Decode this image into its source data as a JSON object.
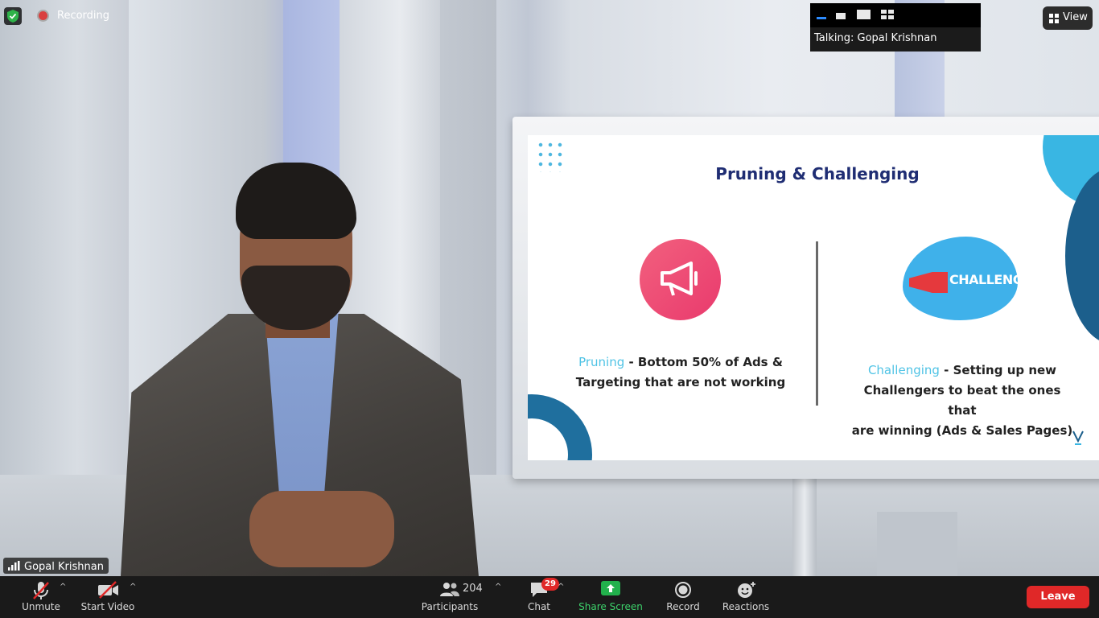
{
  "topbar": {
    "recording_label": "Recording",
    "talking_label": "Talking: Gopal Krishnan",
    "view_label": "View"
  },
  "video": {
    "participant_name": "Gopal Krishnan"
  },
  "slide": {
    "title": "Pruning & Challenging",
    "left_highlight": "Pruning",
    "left_line1": " - Bottom 50% of Ads &",
    "left_line2": "Targeting that are not working",
    "right_highlight": "Challenging",
    "right_line1": " - Setting up new",
    "right_line2": "Challengers to beat the ones that",
    "right_line3": "are winning (Ads & Sales Pages)",
    "challenge_graphic_text": "CHALLENGE"
  },
  "toolbar": {
    "unmute_label": "Unmute",
    "start_video_label": "Start Video",
    "participants_label": "Participants",
    "participants_count": "204",
    "chat_label": "Chat",
    "chat_badge": "29",
    "share_screen_label": "Share Screen",
    "record_label": "Record",
    "reactions_label": "Reactions",
    "leave_label": "Leave"
  },
  "colors": {
    "leave_button": "#e02828",
    "share_screen": "#22b14c",
    "slide_highlight": "#4fc3e5",
    "slide_title": "#1f2d73"
  },
  "icons": [
    "shield-icon",
    "recording-dot-icon",
    "layout-icons",
    "view-grid-icon",
    "signal-bars-icon",
    "microphone-muted-icon",
    "video-off-icon",
    "participants-icon",
    "chat-icon",
    "share-screen-icon",
    "record-icon",
    "reactions-icon",
    "megaphone-icon"
  ]
}
